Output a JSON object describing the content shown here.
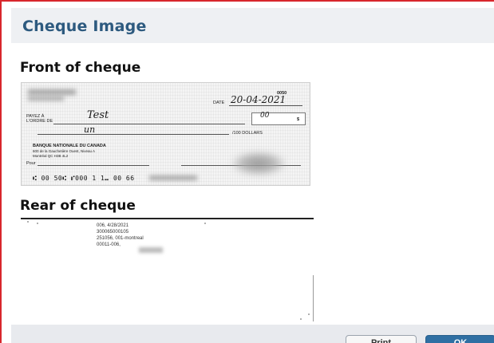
{
  "dialog": {
    "title": "Cheque Image",
    "border_color": "#d8262c",
    "title_color": "#2d5a7f"
  },
  "sections": {
    "front_heading": "Front of cheque",
    "rear_heading": "Rear of cheque"
  },
  "front": {
    "cheque_number": "0050",
    "date_label": "DATE",
    "date_value": "20-04-2021",
    "payee_label_line1": "PAYEZ À",
    "payee_label_line2": "L'ORDRE DE",
    "payee_value": "Test",
    "amount_value": "00",
    "currency_symbol": "$",
    "dollars_label": "/100 DOLLARS",
    "written_amount": "un",
    "bank_name": "BANQUE NATIONALE DU CANADA",
    "bank_address_line1": "600 de la Gauchetière Ouest, Niveau A",
    "bank_address_line2": "Montréal QC H3B 4L2",
    "memo_label": "Pour",
    "micr_line": "⑆ 00 50⑆  ⑈000 1 1⑉ 00 66"
  },
  "rear": {
    "line1": "006, 4/28/2021",
    "line2": "300065000105",
    "line3": "251056, 001-montreal",
    "line4": "00011-006,"
  },
  "buttons": {
    "print_label": "Print",
    "ok_label": "OK",
    "ok_color": "#2f6fa3"
  }
}
